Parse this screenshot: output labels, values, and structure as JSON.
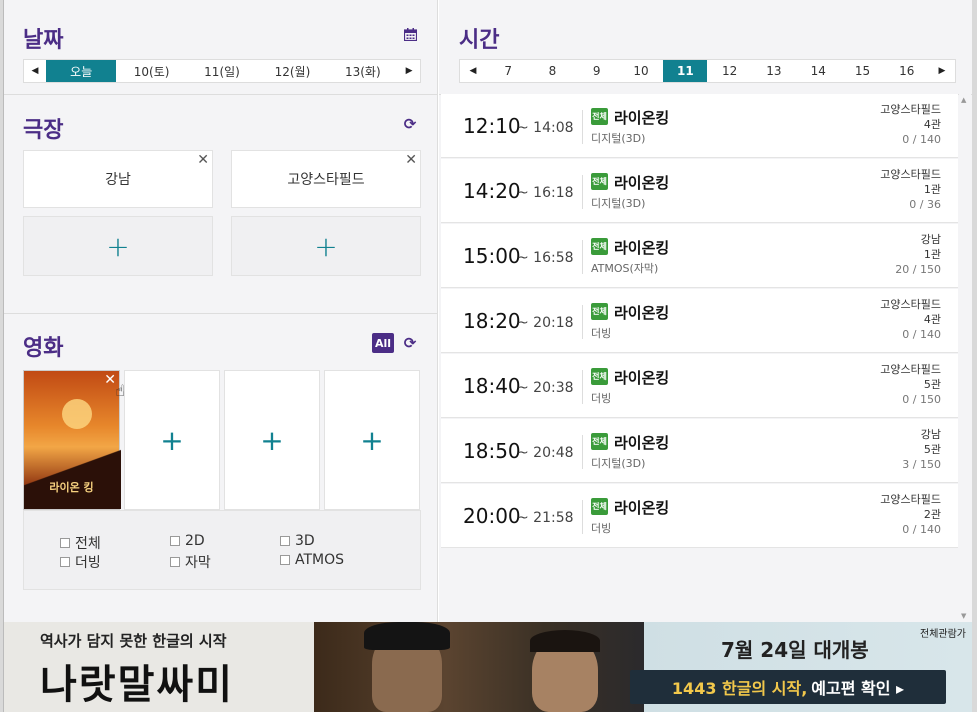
{
  "date_section": {
    "title": "날짜",
    "calendar_icon": "calendar-icon",
    "dates": [
      "오늘",
      "10(토)",
      "11(일)",
      "12(월)",
      "13(화)"
    ],
    "selected_index": 0
  },
  "theater_section": {
    "title": "극장",
    "refresh_icon": "refresh-icon",
    "selected": [
      "강남",
      "고양스타필드"
    ],
    "add_label": "+"
  },
  "movie_section": {
    "title": "영화",
    "all_badge": "All",
    "poster_title": "라이온 킹",
    "add_label": "+",
    "filters": [
      {
        "label": "전체",
        "checked": false
      },
      {
        "label": "2D",
        "checked": false
      },
      {
        "label": "3D",
        "checked": false
      },
      {
        "label": "더빙",
        "checked": false
      },
      {
        "label": "자막",
        "checked": false
      },
      {
        "label": "ATMOS",
        "checked": false
      }
    ]
  },
  "time_section": {
    "title": "시간",
    "hours": [
      "7",
      "8",
      "9",
      "10",
      "11",
      "12",
      "13",
      "14",
      "15",
      "16"
    ],
    "selected_hour": "11"
  },
  "schedules": [
    {
      "start": "12:10",
      "end": "~ 14:08",
      "rating": "전체",
      "title": "라이온킹",
      "format": "디지털(3D)",
      "theater": "고양스타필드",
      "hall": "4관",
      "seats": "0 / 140"
    },
    {
      "start": "14:20",
      "end": "~ 16:18",
      "rating": "전체",
      "title": "라이온킹",
      "format": "디지털(3D)",
      "theater": "고양스타필드",
      "hall": "1관",
      "seats": "0 / 36"
    },
    {
      "start": "15:00",
      "end": "~ 16:58",
      "rating": "전체",
      "title": "라이온킹",
      "format": "ATMOS(자막)",
      "theater": "강남",
      "hall": "1관",
      "seats": "20 / 150"
    },
    {
      "start": "18:20",
      "end": "~ 20:18",
      "rating": "전체",
      "title": "라이온킹",
      "format": "더빙",
      "theater": "고양스타필드",
      "hall": "4관",
      "seats": "0 / 140"
    },
    {
      "start": "18:40",
      "end": "~ 20:38",
      "rating": "전체",
      "title": "라이온킹",
      "format": "더빙",
      "theater": "고양스타필드",
      "hall": "5관",
      "seats": "0 / 150"
    },
    {
      "start": "18:50",
      "end": "~ 20:48",
      "rating": "전체",
      "title": "라이온킹",
      "format": "디지털(3D)",
      "theater": "강남",
      "hall": "5관",
      "seats": "3 / 150"
    },
    {
      "start": "20:00",
      "end": "~ 21:58",
      "rating": "전체",
      "title": "라이온킹",
      "format": "더빙",
      "theater": "고양스타필드",
      "hall": "2관",
      "seats": "0 / 140"
    }
  ],
  "banner": {
    "tagline": "역사가 담지 못한 한글의 시작",
    "title": "나랏말싸미",
    "release": "7월 24일 대개봉",
    "cta_main": "1443 한글의 시작,",
    "cta_link": "예고편 확인 ▸",
    "close_all": "전체관람가"
  },
  "colors": {
    "accent": "#4b2d86",
    "teal": "#118190",
    "rating_green": "#3a9b3a"
  }
}
